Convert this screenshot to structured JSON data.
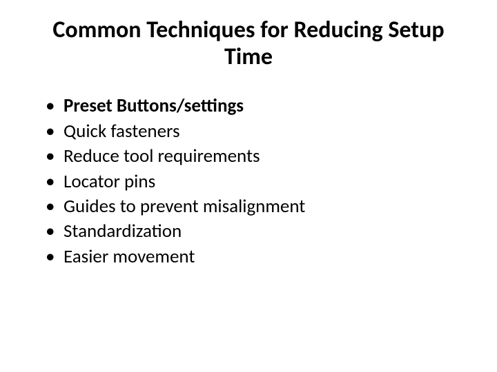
{
  "title": "Common Techniques for Reducing Setup Time",
  "bullets": [
    {
      "text": "Preset Buttons/settings",
      "bold": true
    },
    {
      "text": "Quick fasteners",
      "bold": false
    },
    {
      "text": "Reduce tool requirements",
      "bold": false
    },
    {
      "text": "Locator pins",
      "bold": false
    },
    {
      "text": "Guides to prevent misalignment",
      "bold": false
    },
    {
      "text": "Standardization",
      "bold": false
    },
    {
      "text": "Easier movement",
      "bold": false
    }
  ]
}
